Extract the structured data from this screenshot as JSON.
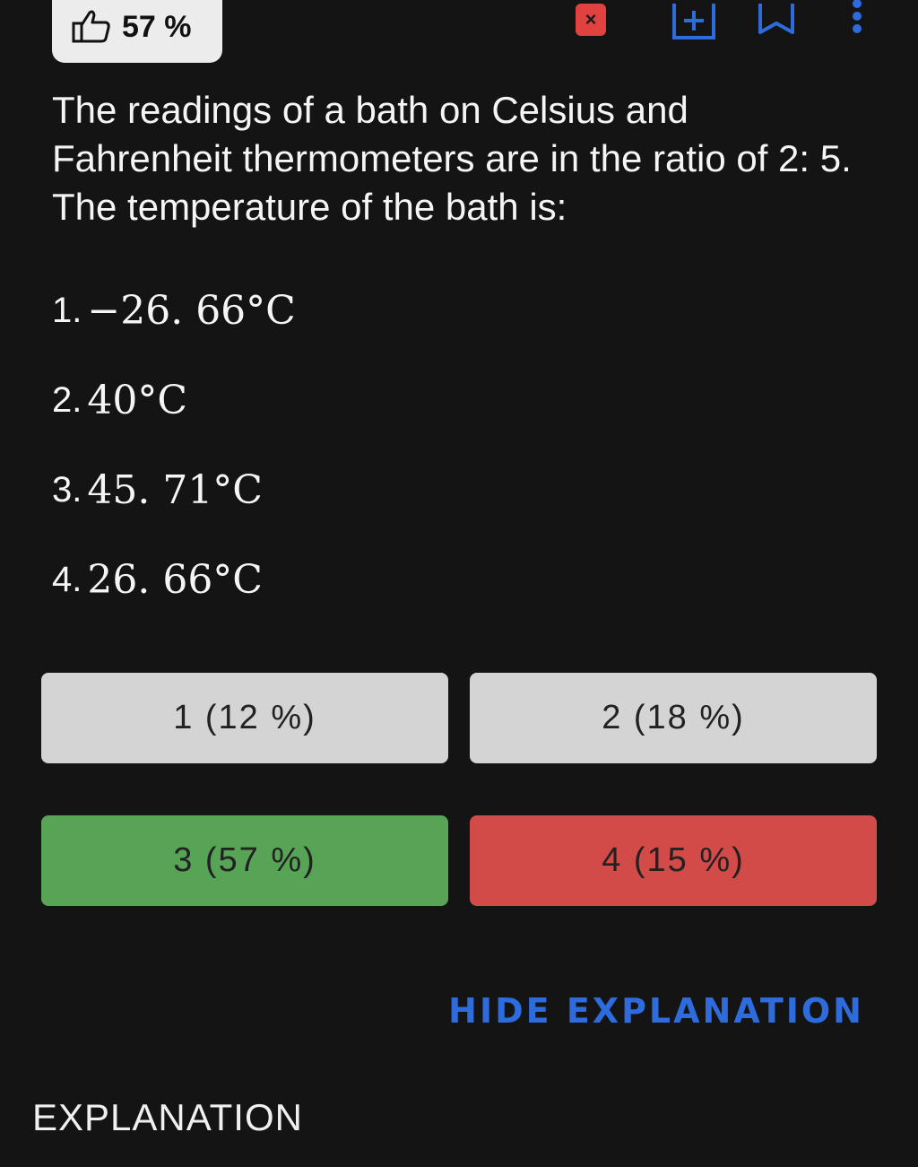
{
  "header": {
    "like_percent": "57 %",
    "close_label": "×"
  },
  "question": {
    "text": "The readings of a bath on Celsius and Fahrenheit thermometers are in the ratio of 2: 5. The temperature of the bath is:"
  },
  "options": [
    {
      "num": "1.",
      "value": "−26. 66°C"
    },
    {
      "num": "2.",
      "value": "40°C"
    },
    {
      "num": "3.",
      "value": "45. 71°C"
    },
    {
      "num": "4.",
      "value": "26. 66°C"
    }
  ],
  "answers": [
    {
      "label": "1 (12 %)",
      "status": "neutral"
    },
    {
      "label": "2 (18 %)",
      "status": "neutral"
    },
    {
      "label": "3 (57 %)",
      "status": "correct"
    },
    {
      "label": "4 (15 %)",
      "status": "wrong"
    }
  ],
  "colors": {
    "neutral": "#d4d4d4",
    "correct": "#57a457",
    "wrong": "#d24b48",
    "accent": "#2e6bdc"
  },
  "explanation": {
    "toggle_label": "HIDE EXPLANATION",
    "title": "EXPLANATION"
  }
}
